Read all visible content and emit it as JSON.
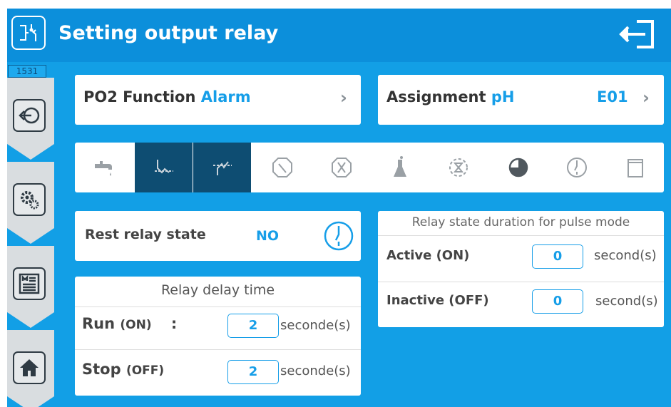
{
  "header": {
    "title": "Setting output relay",
    "title_icon": "relay-switch-icon",
    "exit_icon": "exit-icon"
  },
  "id_badge": "1531",
  "sidebar": [
    {
      "name": "back",
      "icon": "back-arrow-icon"
    },
    {
      "name": "settings",
      "icon": "gears-icon"
    },
    {
      "name": "menu",
      "icon": "menu-list-icon"
    },
    {
      "name": "home",
      "icon": "home-icon"
    }
  ],
  "function_card": {
    "label": "PO2 Function",
    "value": "Alarm"
  },
  "assignment_card": {
    "label": "Assignment",
    "value": "pH",
    "code": "E01"
  },
  "function_icons": [
    {
      "icon": "faucet-icon",
      "selected": false
    },
    {
      "icon": "low-threshold-icon",
      "selected": true
    },
    {
      "icon": "high-threshold-icon",
      "selected": true
    },
    {
      "icon": "prohibited-icon",
      "selected": false
    },
    {
      "icon": "fan-off-icon",
      "selected": false
    },
    {
      "icon": "flask-icon",
      "selected": false
    },
    {
      "icon": "timer-cycle-icon",
      "selected": false
    },
    {
      "icon": "pie-clock-icon",
      "selected": false
    },
    {
      "icon": "clock-icon",
      "selected": false
    },
    {
      "icon": "container-icon",
      "selected": false
    }
  ],
  "rest_relay": {
    "label": "Rest relay state",
    "value": "NO"
  },
  "delay": {
    "title": "Relay delay time",
    "run_label": "Run",
    "run_sub": "(ON)",
    "run_colon": ":",
    "run_value": "2",
    "run_unit": "seconde(s)",
    "stop_label": "Stop",
    "stop_sub": "(OFF)",
    "stop_value": "2",
    "stop_unit": "seconde(s)"
  },
  "pulse": {
    "title": "Relay state duration for pulse mode",
    "active_label": "Active (ON)",
    "active_value": "0",
    "active_unit": "second(s)",
    "inactive_label": "Inactive (OFF)",
    "inactive_value": "0",
    "inactive_unit": "second(s)"
  },
  "colors": {
    "primary": "#129fe6",
    "header": "#0c8fdb",
    "accent_text": "#169ee8",
    "selected_tile": "#0e4d72"
  }
}
